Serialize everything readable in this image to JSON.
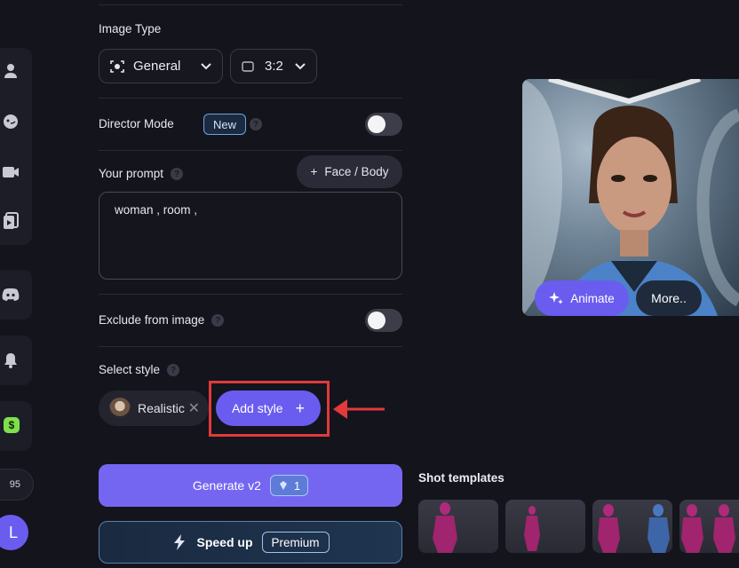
{
  "rail": {
    "balance": "95",
    "avatar_letter": "L"
  },
  "panel": {
    "image_type_label": "Image Type",
    "image_type_value": "General",
    "aspect_value": "3:2",
    "director_mode_label": "Director Mode",
    "director_badge": "New",
    "your_prompt_label": "Your prompt",
    "face_body_label": "Face / Body",
    "prompt_text": "woman , room ,",
    "exclude_label": "Exclude from image",
    "select_style_label": "Select style",
    "style_chip_label": "Realistic",
    "add_style_label": "Add style",
    "generate_label": "Generate v2",
    "generate_cost": "1",
    "speed_up_label": "Speed up",
    "premium_label": "Premium"
  },
  "preview": {
    "animate_label": "Animate",
    "more_label": "More.."
  },
  "shot_templates": {
    "title": "Shot templates"
  },
  "colors": {
    "accent": "#6b5cf0",
    "highlight": "#e03a3a",
    "background": "#14141c"
  }
}
